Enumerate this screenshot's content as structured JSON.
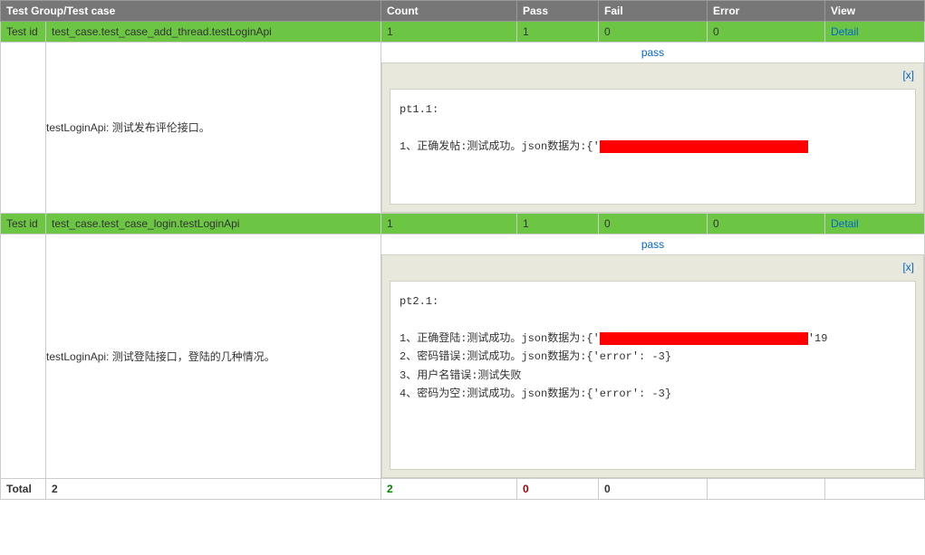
{
  "headers": {
    "test_group": "Test Group/Test case",
    "count": "Count",
    "pass": "Pass",
    "fail": "Fail",
    "error": "Error",
    "view": "View"
  },
  "rows": [
    {
      "id_label": "Test id",
      "name": "test_case.test_case_add_thread.testLoginApi",
      "count": "1",
      "pass": "1",
      "fail": "0",
      "error": "0",
      "view_label": "Detail",
      "desc": "testLoginApi: 测试发布评伦接口。",
      "status": "pass",
      "close": "[x]",
      "pre_header": "pt1.1:",
      "pre_lines": [
        "1、正确发帖:测试成功。json数据为:{'"
      ]
    },
    {
      "id_label": "Test id",
      "name": "test_case.test_case_login.testLoginApi",
      "count": "1",
      "pass": "1",
      "fail": "0",
      "error": "0",
      "view_label": "Detail",
      "desc": "testLoginApi: 测试登陆接口，登陆的几种情况。",
      "status": "pass",
      "close": "[x]",
      "pre_header": "pt2.1:",
      "pre_lines": [
        "1、正确登陆:测试成功。json数据为:{'",
        "2、密码错误:测试成功。json数据为:{'error': -3}",
        "3、用户名错误:测试失败",
        "4、密码为空:测试成功。json数据为:{'error': -3}"
      ],
      "pre_line1_suffix": "'19"
    }
  ],
  "total": {
    "label": "Total",
    "count": "2",
    "pass": "2",
    "fail": "0",
    "error": "0"
  }
}
